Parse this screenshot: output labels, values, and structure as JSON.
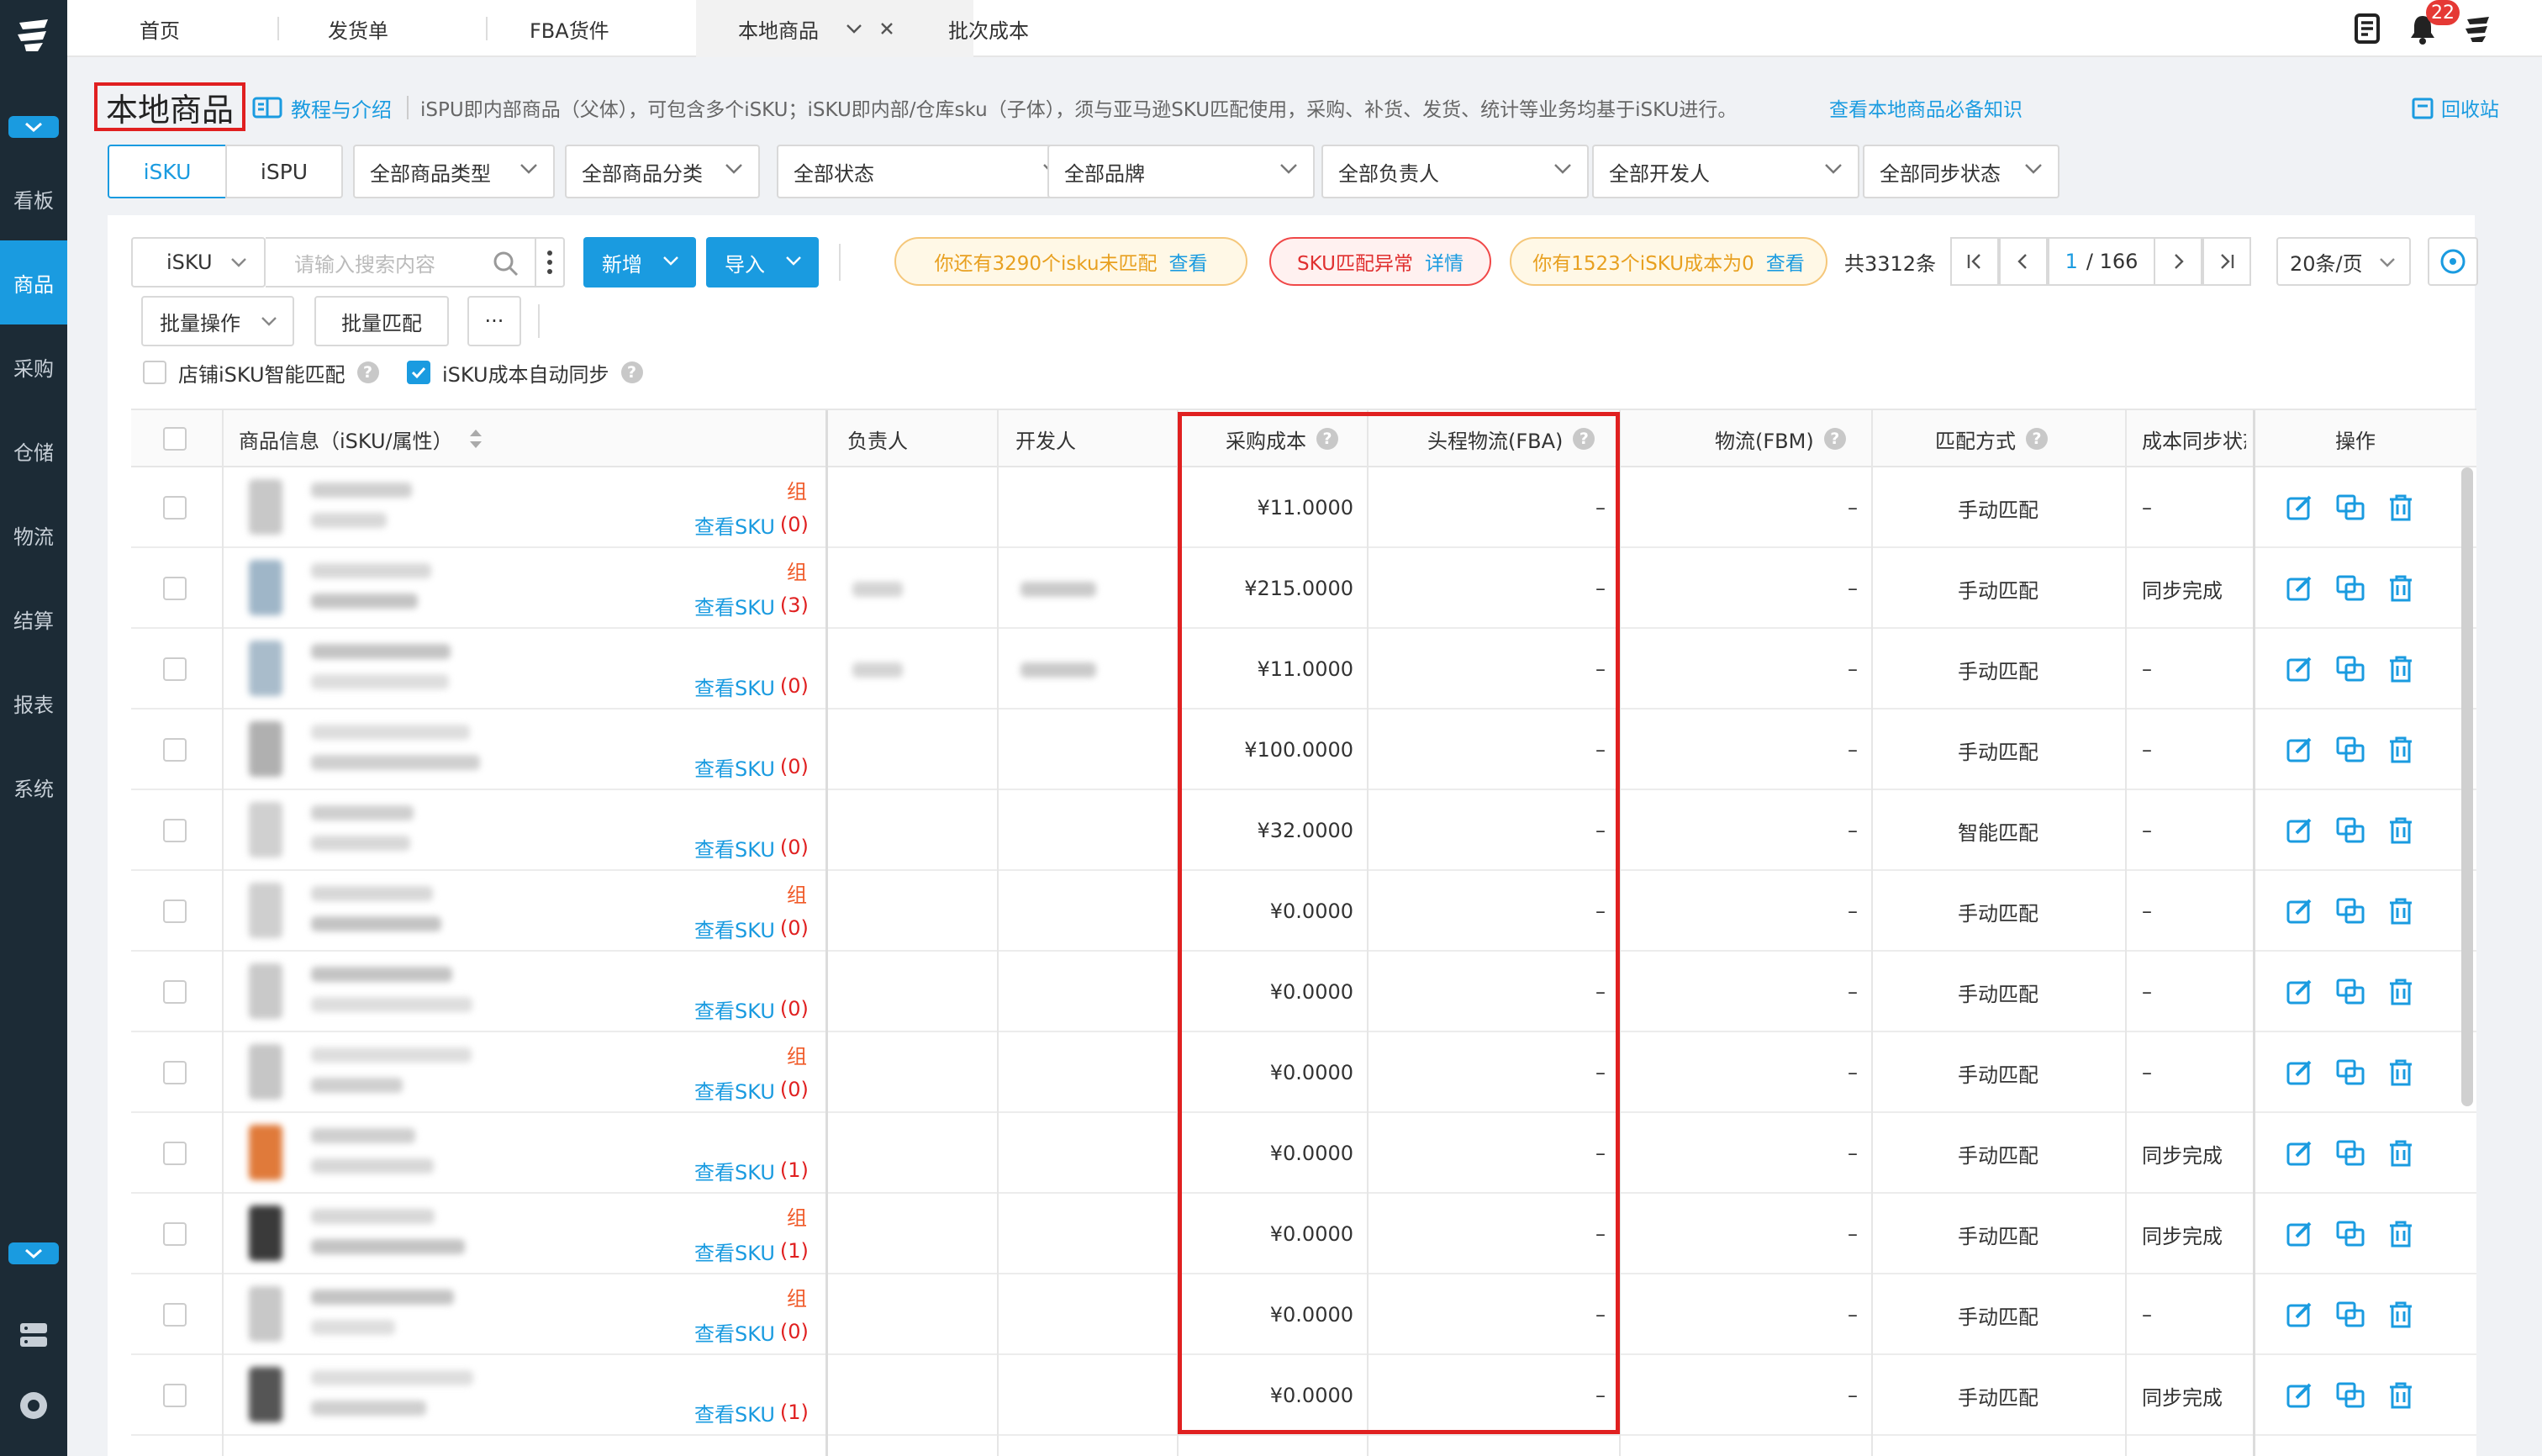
{
  "nav": {
    "items": [
      {
        "key": "dashboard",
        "label": "看板"
      },
      {
        "key": "products",
        "label": "商品",
        "active": true
      },
      {
        "key": "purchase",
        "label": "采购"
      },
      {
        "key": "storage",
        "label": "仓储"
      },
      {
        "key": "logistics",
        "label": "物流"
      },
      {
        "key": "settlement",
        "label": "结算"
      },
      {
        "key": "reports",
        "label": "报表"
      },
      {
        "key": "system",
        "label": "系统"
      }
    ]
  },
  "tabs": [
    "首页",
    "发货单",
    "FBA货件",
    "本地商品",
    "批次成本"
  ],
  "notifications": {
    "count": "22"
  },
  "header": {
    "title": "本地商品",
    "help": "教程与介绍",
    "hint": "iSPU即内部商品（父体），可包含多个iSKU；iSKU即内部/仓库sku（子体），须与亚马逊SKU匹配使用，采购、补货、发货、统计等业务均基于iSKU进行。",
    "hint_link": "查看本地商品必备知识",
    "recycle": "回收站"
  },
  "segments": [
    "iSKU",
    "iSPU"
  ],
  "filters": [
    "全部商品类型",
    "全部商品分类",
    "全部状态",
    "全部品牌",
    "全部负责人",
    "全部开发人",
    "全部同步状态"
  ],
  "search": {
    "field": "iSKU",
    "placeholder": "请输入搜索内容"
  },
  "buttons": {
    "add": "新增",
    "import": "导入",
    "batch": "批量操作",
    "batch_match": "批量匹配",
    "more": "···"
  },
  "alerts": {
    "unmatched": {
      "text": "你还有3290个isku未匹配",
      "link": "查看"
    },
    "error": {
      "text": "SKU匹配异常",
      "link": "详情"
    },
    "zero_cost": {
      "text": "你有1523个iSKU成本为0",
      "link": "查看"
    }
  },
  "pagination": {
    "total": "共3312条",
    "current": "1",
    "pages": "/ 166",
    "page_size": "20条/页"
  },
  "options": {
    "smart_match": "店铺iSKU智能匹配",
    "auto_sync": "iSKU成本自动同步",
    "auto_sync_checked": true
  },
  "columns": {
    "product": "商品信息（iSKU/属性）",
    "owner": "负责人",
    "developer": "开发人",
    "purchase_cost": "采购成本",
    "fba": "头程物流(FBA)",
    "fbm": "物流(FBM)",
    "match": "匹配方式",
    "sync": "成本同步状态",
    "ops": "操作"
  },
  "rows": [
    {
      "group": "组",
      "view": "查看SKU",
      "count": "(0)",
      "cost": "¥11.0000",
      "fba": "–",
      "fbm": "–",
      "match": "手动匹配",
      "sync": "–"
    },
    {
      "group": "组",
      "view": "查看SKU",
      "count": "(3)",
      "cost": "¥215.0000",
      "fba": "–",
      "fbm": "–",
      "match": "手动匹配",
      "sync": "同步完成"
    },
    {
      "group": "",
      "view": "查看SKU",
      "count": "(0)",
      "cost": "¥11.0000",
      "fba": "–",
      "fbm": "–",
      "match": "手动匹配",
      "sync": "–"
    },
    {
      "group": "",
      "view": "查看SKU",
      "count": "(0)",
      "cost": "¥100.0000",
      "fba": "–",
      "fbm": "–",
      "match": "手动匹配",
      "sync": "–"
    },
    {
      "group": "",
      "view": "查看SKU",
      "count": "(0)",
      "cost": "¥32.0000",
      "fba": "–",
      "fbm": "–",
      "match": "智能匹配",
      "sync": "–"
    },
    {
      "group": "组",
      "view": "查看SKU",
      "count": "(0)",
      "cost": "¥0.0000",
      "fba": "–",
      "fbm": "–",
      "match": "手动匹配",
      "sync": "–"
    },
    {
      "group": "",
      "view": "查看SKU",
      "count": "(0)",
      "cost": "¥0.0000",
      "fba": "–",
      "fbm": "–",
      "match": "手动匹配",
      "sync": "–"
    },
    {
      "group": "组",
      "view": "查看SKU",
      "count": "(0)",
      "cost": "¥0.0000",
      "fba": "–",
      "fbm": "–",
      "match": "手动匹配",
      "sync": "–"
    },
    {
      "group": "",
      "view": "查看SKU",
      "count": "(1)",
      "cost": "¥0.0000",
      "fba": "–",
      "fbm": "–",
      "match": "手动匹配",
      "sync": "同步完成"
    },
    {
      "group": "组",
      "view": "查看SKU",
      "count": "(1)",
      "cost": "¥0.0000",
      "fba": "–",
      "fbm": "–",
      "match": "手动匹配",
      "sync": "同步完成"
    },
    {
      "group": "组",
      "view": "查看SKU",
      "count": "(0)",
      "cost": "¥0.0000",
      "fba": "–",
      "fbm": "–",
      "match": "手动匹配",
      "sync": "–"
    },
    {
      "group": "",
      "view": "查看SKU",
      "count": "(1)",
      "cost": "¥0.0000",
      "fba": "–",
      "fbm": "–",
      "match": "手动匹配",
      "sync": "同步完成"
    }
  ],
  "colors": {
    "accent": "#1a9be0",
    "sidebar": "#1c2b36",
    "highlight": "#e02020",
    "warn": "#e8a020"
  }
}
